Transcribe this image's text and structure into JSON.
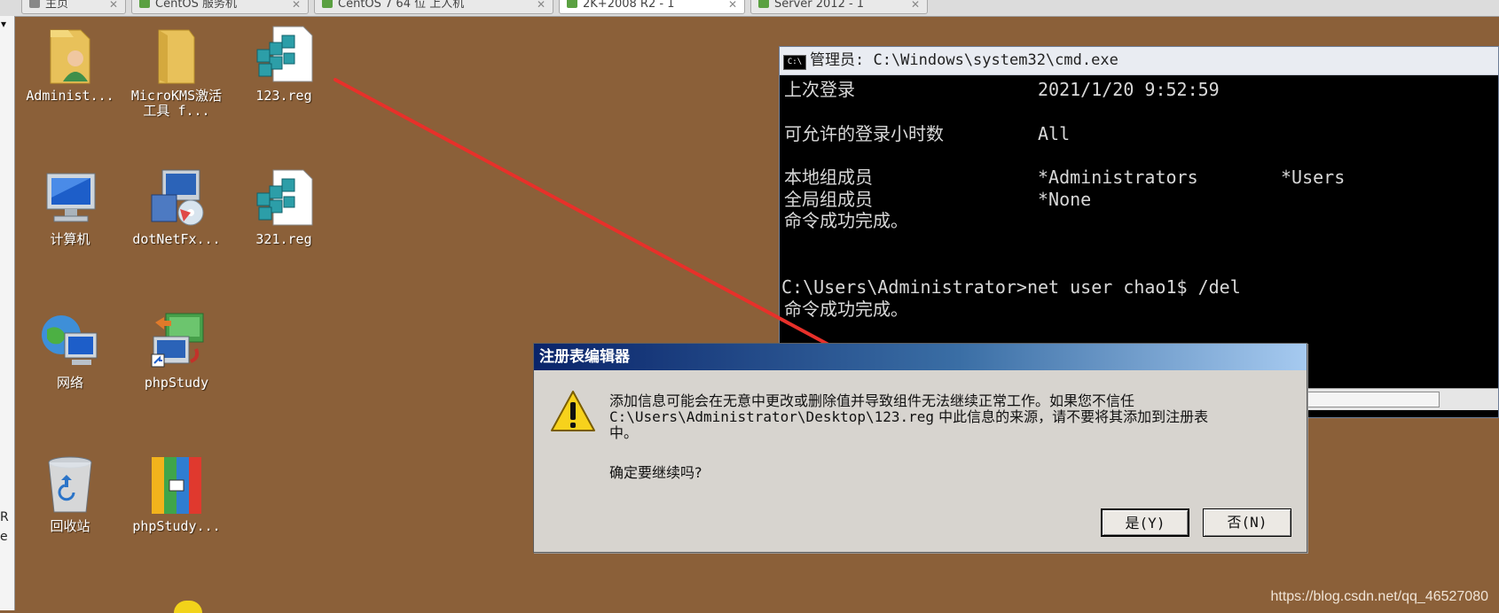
{
  "tabs": [
    {
      "label": "主页"
    },
    {
      "label": "CentOS 服务机"
    },
    {
      "label": "CentOS 7 64 位 上人机"
    },
    {
      "label": "2K+2008 R2 - 1"
    },
    {
      "label": "Server 2012 - 1"
    }
  ],
  "left_pane": {
    "dropdown": "▾",
    "text_r": "R",
    "text_e": "e"
  },
  "desktop_icons": [
    {
      "label": "Administ...",
      "icon": "user-folder-icon"
    },
    {
      "label": "MicroKMS激活工具 f...",
      "icon": "folder-icon"
    },
    {
      "label": "123.reg",
      "icon": "registry-file-icon"
    },
    {
      "label": "计算机",
      "icon": "computer-icon"
    },
    {
      "label": "dotNetFx...",
      "icon": "installer-icon"
    },
    {
      "label": "321.reg",
      "icon": "registry-file-icon"
    },
    {
      "label": "网络",
      "icon": "network-icon"
    },
    {
      "label": "phpStudy",
      "icon": "shortcut-icon"
    },
    {
      "label": "回收站",
      "icon": "recycle-bin-icon"
    },
    {
      "label": "phpStudy...",
      "icon": "archive-icon"
    }
  ],
  "cmd": {
    "title": "管理员: C:\\Windows\\system32\\cmd.exe",
    "lines": [
      {
        "col1": "上次登录",
        "col2": "2021/1/20 9:52:59",
        "col3": ""
      },
      {
        "col1": "可允许的登录小时数",
        "col2": "All",
        "col3": ""
      },
      {
        "col1": "本地组成员",
        "col2": "*Administrators",
        "col3": "*Users"
      },
      {
        "col1": "全局组成员",
        "col2": "*None",
        "col3": ""
      },
      {
        "col1": "命令成功完成。",
        "col2": "",
        "col3": ""
      },
      {
        "col1": "C:\\Users\\Administrator>net user chao1$ /del",
        "col2": "",
        "col3": ""
      },
      {
        "col1": "命令成功完成。",
        "col2": "",
        "col3": ""
      }
    ]
  },
  "dialog": {
    "title": "注册表编辑器",
    "message_line1": "添加信息可能会在无意中更改或删除值并导致组件无法继续正常工作。如果您不信任",
    "message_path": "C:\\Users\\Administrator\\Desktop\\123.reg",
    "message_line2_rest": " 中此信息的来源，请不要将其添加到注册表",
    "message_line3": "中。",
    "question": "确定要继续吗?",
    "yes_button": "是(Y)",
    "no_button": "否(N)"
  },
  "colors": {
    "desktop": "#8b6039",
    "arrow": "#e8302a"
  },
  "watermark": "https://blog.csdn.net/qq_46527080"
}
